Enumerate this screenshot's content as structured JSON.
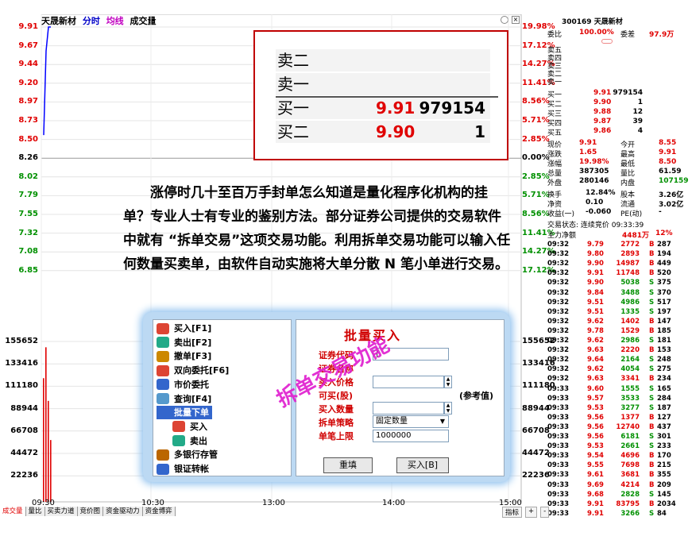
{
  "header": {
    "stock_name": "天晟新材",
    "tab_fenshi": "分时",
    "tab_junxian": "均线",
    "tab_volume": "成交量"
  },
  "chart_data": {
    "type": "line",
    "title": "",
    "x_ticks": [
      "09:30",
      "10:30",
      "13:00",
      "14:00",
      "15:00"
    ],
    "price_ticks": [
      "9.91",
      "9.67",
      "9.44",
      "9.20",
      "8.97",
      "8.73",
      "8.50",
      "8.26",
      "8.02",
      "7.79",
      "7.55",
      "7.32",
      "7.08",
      "6.85"
    ],
    "pct_ticks": [
      "19.98%",
      "17.12%",
      "14.27%",
      "11.41%",
      "8.56%",
      "5.71%",
      "2.85%",
      "0.00%",
      "2.85%",
      "5.71%",
      "8.56%",
      "11.41%",
      "14.27%",
      "17.12%"
    ],
    "volume_ticks": [
      "155652",
      "133416",
      "111180",
      "88944",
      "66708",
      "44472",
      "22236"
    ],
    "ylim": [
      6.61,
      9.91
    ],
    "series": [
      {
        "x": [
          "09:30",
          "09:31",
          "09:32",
          "09:33"
        ],
        "values": [
          8.55,
          9.61,
          9.91,
          9.91
        ]
      }
    ],
    "volume": [
      {
        "x": "09:30",
        "value": 120000
      },
      {
        "x": "09:31",
        "value": 150000
      },
      {
        "x": "09:32",
        "value": 98000
      },
      {
        "x": "09:33",
        "value": 60000
      }
    ]
  },
  "side": {
    "code_title": "300169 天晟新材",
    "weibi_label": "委比",
    "weibi_value": "100.00%",
    "weicha_label": "委差",
    "weicha_value": "97.9万",
    "sell_labels": [
      "卖五",
      "卖四",
      "卖三",
      "卖二",
      "卖一"
    ],
    "buy": [
      {
        "label": "买一",
        "price": "9.91",
        "vol": "979154"
      },
      {
        "label": "买二",
        "price": "9.90",
        "vol": "1"
      },
      {
        "label": "买三",
        "price": "9.88",
        "vol": "12"
      },
      {
        "label": "买四",
        "price": "9.87",
        "vol": "39"
      },
      {
        "label": "买五",
        "price": "9.86",
        "vol": "4"
      }
    ],
    "stats": [
      [
        "现价",
        "9.91",
        "今开",
        "8.55"
      ],
      [
        "涨跌",
        "1.65",
        "最高",
        "9.91"
      ],
      [
        "涨幅",
        "19.98%",
        "最低",
        "8.50"
      ],
      [
        "总量",
        "387305",
        "量比",
        "61.59"
      ],
      [
        "外盘",
        "280146",
        "内盘",
        "107159"
      ]
    ],
    "stats2": [
      [
        "换手",
        "12.84%",
        "股本",
        "3.26亿"
      ],
      [
        "净资",
        "0.10",
        "流通",
        "3.02亿"
      ],
      [
        "收益(一)",
        "-0.060",
        "PE(动)",
        "-"
      ]
    ],
    "status": "交易状态: 连续竞价 09:33:39",
    "main_label": "主力净额",
    "main_value": "4481万",
    "main_pct": "12%",
    "ticks": [
      [
        "09:32",
        "9.79",
        "2772",
        "B",
        "287"
      ],
      [
        "09:32",
        "9.80",
        "2893",
        "B",
        "194"
      ],
      [
        "09:32",
        "9.90",
        "14987",
        "B",
        "449"
      ],
      [
        "09:32",
        "9.91",
        "11748",
        "B",
        "520"
      ],
      [
        "09:32",
        "9.90",
        "5038",
        "S",
        "375"
      ],
      [
        "09:32",
        "9.84",
        "3488",
        "S",
        "370"
      ],
      [
        "09:32",
        "9.51",
        "4986",
        "S",
        "517"
      ],
      [
        "09:32",
        "9.51",
        "1335",
        "S",
        "197"
      ],
      [
        "09:32",
        "9.62",
        "1402",
        "B",
        "147"
      ],
      [
        "09:32",
        "9.78",
        "1529",
        "B",
        "185"
      ],
      [
        "09:32",
        "9.62",
        "2986",
        "S",
        "181"
      ],
      [
        "09:32",
        "9.63",
        "2220",
        "B",
        "153"
      ],
      [
        "09:32",
        "9.64",
        "2164",
        "S",
        "248"
      ],
      [
        "09:32",
        "9.62",
        "4054",
        "S",
        "275"
      ],
      [
        "09:32",
        "9.63",
        "3341",
        "B",
        "234"
      ],
      [
        "09:33",
        "9.60",
        "1555",
        "S",
        "165"
      ],
      [
        "09:33",
        "9.57",
        "3533",
        "S",
        "284"
      ],
      [
        "09:33",
        "9.53",
        "3277",
        "S",
        "187"
      ],
      [
        "09:33",
        "9.56",
        "1377",
        "B",
        "127"
      ],
      [
        "09:33",
        "9.56",
        "12740",
        "B",
        "437"
      ],
      [
        "09:33",
        "9.56",
        "6181",
        "S",
        "301"
      ],
      [
        "09:33",
        "9.53",
        "2661",
        "S",
        "233"
      ],
      [
        "09:33",
        "9.54",
        "4696",
        "B",
        "170"
      ],
      [
        "09:33",
        "9.55",
        "7698",
        "B",
        "215"
      ],
      [
        "09:33",
        "9.61",
        "3681",
        "B",
        "355"
      ],
      [
        "09:33",
        "9.69",
        "4214",
        "B",
        "209"
      ],
      [
        "09:33",
        "9.68",
        "2828",
        "S",
        "145"
      ],
      [
        "09:33",
        "9.91",
        "83795",
        "B",
        "2034"
      ],
      [
        "09:33",
        "9.91",
        "3266",
        "S",
        "84"
      ]
    ]
  },
  "bottom_tabs": [
    "成交量",
    "量比",
    "买卖力道",
    "竞价图",
    "资金驱动力",
    "资金博弈"
  ],
  "bottom_right": [
    "指标",
    "+",
    "-"
  ],
  "zoom": {
    "rows": [
      {
        "label": "卖二",
        "price": "",
        "vol": ""
      },
      {
        "label": "卖一",
        "price": "",
        "vol": ""
      },
      {
        "label": "买一",
        "price": "9.91",
        "vol": "979154"
      },
      {
        "label": "买二",
        "price": "9.90",
        "vol": "1"
      }
    ]
  },
  "paragraph": "涨停时几十至百万手封单怎么知道是量化程序化机构的挂单？专业人士有专业的鉴别方法。部分证券公司提供的交易软件中就有 “拆单交易”这项交易功能。利用拆单交易功能可以输入任何数量买卖单，由软件自动实施将大单分散 N 笔小单进行交易。",
  "dialog": {
    "menu": [
      {
        "label": "买入[F1]",
        "icon": "BUY"
      },
      {
        "label": "卖出[F2]",
        "icon": "SELL"
      },
      {
        "label": "撤单[F3]",
        "icon": "CANCEL"
      },
      {
        "label": "双向委托[F6]",
        "icon": "BOTH"
      },
      {
        "label": "市价委托",
        "icon": "MKT"
      },
      {
        "label": "查询[F4]",
        "icon": "QRY"
      },
      {
        "label": "批量下单",
        "icon": "BATCH"
      },
      {
        "label": "买入",
        "icon": "BUY"
      },
      {
        "label": "卖出",
        "icon": "SELL"
      },
      {
        "label": "多银行存管",
        "icon": "BANK"
      },
      {
        "label": "银证转帐",
        "icon": "XFER"
      }
    ],
    "form_title": "批量买入",
    "labels": [
      "证券代码",
      "证券名称",
      "买入价格",
      "可买(股)",
      "买入数量",
      "拆单策略",
      "单笔上限"
    ],
    "strategy_value": "固定数量",
    "max_value": "1000000",
    "ref_label": "(参考值)",
    "reset_button": "重填",
    "buy_button": "买入[B]",
    "stamp": "拆单交易功能"
  }
}
